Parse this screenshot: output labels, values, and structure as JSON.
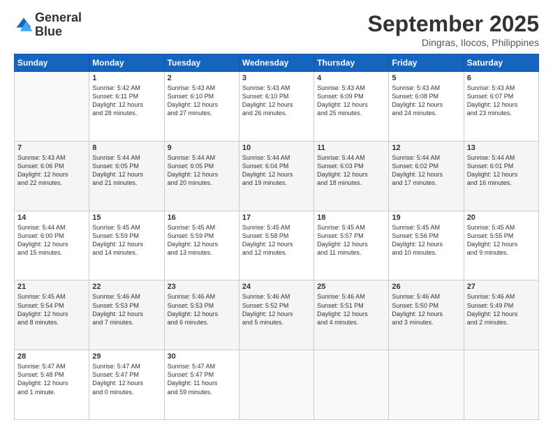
{
  "logo": {
    "line1": "General",
    "line2": "Blue"
  },
  "title": "September 2025",
  "location": "Dingras, Ilocos, Philippines",
  "weekdays": [
    "Sunday",
    "Monday",
    "Tuesday",
    "Wednesday",
    "Thursday",
    "Friday",
    "Saturday"
  ],
  "weeks": [
    [
      {
        "day": "",
        "info": ""
      },
      {
        "day": "1",
        "info": "Sunrise: 5:42 AM\nSunset: 6:11 PM\nDaylight: 12 hours\nand 28 minutes."
      },
      {
        "day": "2",
        "info": "Sunrise: 5:43 AM\nSunset: 6:10 PM\nDaylight: 12 hours\nand 27 minutes."
      },
      {
        "day": "3",
        "info": "Sunrise: 5:43 AM\nSunset: 6:10 PM\nDaylight: 12 hours\nand 26 minutes."
      },
      {
        "day": "4",
        "info": "Sunrise: 5:43 AM\nSunset: 6:09 PM\nDaylight: 12 hours\nand 25 minutes."
      },
      {
        "day": "5",
        "info": "Sunrise: 5:43 AM\nSunset: 6:08 PM\nDaylight: 12 hours\nand 24 minutes."
      },
      {
        "day": "6",
        "info": "Sunrise: 5:43 AM\nSunset: 6:07 PM\nDaylight: 12 hours\nand 23 minutes."
      }
    ],
    [
      {
        "day": "7",
        "info": "Sunrise: 5:43 AM\nSunset: 6:06 PM\nDaylight: 12 hours\nand 22 minutes."
      },
      {
        "day": "8",
        "info": "Sunrise: 5:44 AM\nSunset: 6:05 PM\nDaylight: 12 hours\nand 21 minutes."
      },
      {
        "day": "9",
        "info": "Sunrise: 5:44 AM\nSunset: 6:05 PM\nDaylight: 12 hours\nand 20 minutes."
      },
      {
        "day": "10",
        "info": "Sunrise: 5:44 AM\nSunset: 6:04 PM\nDaylight: 12 hours\nand 19 minutes."
      },
      {
        "day": "11",
        "info": "Sunrise: 5:44 AM\nSunset: 6:03 PM\nDaylight: 12 hours\nand 18 minutes."
      },
      {
        "day": "12",
        "info": "Sunrise: 5:44 AM\nSunset: 6:02 PM\nDaylight: 12 hours\nand 17 minutes."
      },
      {
        "day": "13",
        "info": "Sunrise: 5:44 AM\nSunset: 6:01 PM\nDaylight: 12 hours\nand 16 minutes."
      }
    ],
    [
      {
        "day": "14",
        "info": "Sunrise: 5:44 AM\nSunset: 6:00 PM\nDaylight: 12 hours\nand 15 minutes."
      },
      {
        "day": "15",
        "info": "Sunrise: 5:45 AM\nSunset: 5:59 PM\nDaylight: 12 hours\nand 14 minutes."
      },
      {
        "day": "16",
        "info": "Sunrise: 5:45 AM\nSunset: 5:59 PM\nDaylight: 12 hours\nand 13 minutes."
      },
      {
        "day": "17",
        "info": "Sunrise: 5:45 AM\nSunset: 5:58 PM\nDaylight: 12 hours\nand 12 minutes."
      },
      {
        "day": "18",
        "info": "Sunrise: 5:45 AM\nSunset: 5:57 PM\nDaylight: 12 hours\nand 11 minutes."
      },
      {
        "day": "19",
        "info": "Sunrise: 5:45 AM\nSunset: 5:56 PM\nDaylight: 12 hours\nand 10 minutes."
      },
      {
        "day": "20",
        "info": "Sunrise: 5:45 AM\nSunset: 5:55 PM\nDaylight: 12 hours\nand 9 minutes."
      }
    ],
    [
      {
        "day": "21",
        "info": "Sunrise: 5:45 AM\nSunset: 5:54 PM\nDaylight: 12 hours\nand 8 minutes."
      },
      {
        "day": "22",
        "info": "Sunrise: 5:46 AM\nSunset: 5:53 PM\nDaylight: 12 hours\nand 7 minutes."
      },
      {
        "day": "23",
        "info": "Sunrise: 5:46 AM\nSunset: 5:53 PM\nDaylight: 12 hours\nand 6 minutes."
      },
      {
        "day": "24",
        "info": "Sunrise: 5:46 AM\nSunset: 5:52 PM\nDaylight: 12 hours\nand 5 minutes."
      },
      {
        "day": "25",
        "info": "Sunrise: 5:46 AM\nSunset: 5:51 PM\nDaylight: 12 hours\nand 4 minutes."
      },
      {
        "day": "26",
        "info": "Sunrise: 5:46 AM\nSunset: 5:50 PM\nDaylight: 12 hours\nand 3 minutes."
      },
      {
        "day": "27",
        "info": "Sunrise: 5:46 AM\nSunset: 5:49 PM\nDaylight: 12 hours\nand 2 minutes."
      }
    ],
    [
      {
        "day": "28",
        "info": "Sunrise: 5:47 AM\nSunset: 5:48 PM\nDaylight: 12 hours\nand 1 minute."
      },
      {
        "day": "29",
        "info": "Sunrise: 5:47 AM\nSunset: 5:47 PM\nDaylight: 12 hours\nand 0 minutes."
      },
      {
        "day": "30",
        "info": "Sunrise: 5:47 AM\nSunset: 5:47 PM\nDaylight: 11 hours\nand 59 minutes."
      },
      {
        "day": "",
        "info": ""
      },
      {
        "day": "",
        "info": ""
      },
      {
        "day": "",
        "info": ""
      },
      {
        "day": "",
        "info": ""
      }
    ]
  ]
}
